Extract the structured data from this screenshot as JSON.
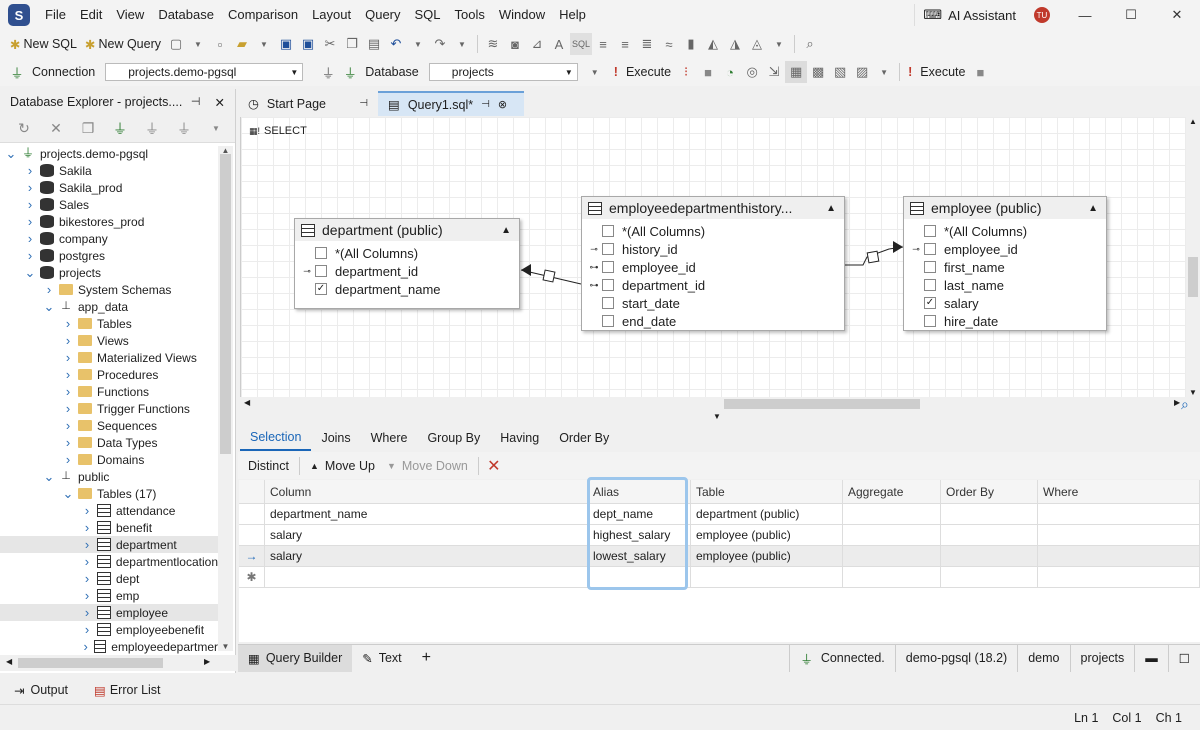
{
  "menu": [
    "File",
    "Edit",
    "View",
    "Database",
    "Comparison",
    "Layout",
    "Query",
    "SQL",
    "Tools",
    "Window",
    "Help"
  ],
  "ai_assistant": "AI Assistant",
  "user_initials": "TU",
  "toolbar1": {
    "new_sql": "New SQL",
    "new_query": "New Query"
  },
  "toolbar2": {
    "connection_label": "Connection",
    "connection_value": "projects.demo-pgsql",
    "database_label": "Database",
    "database_value": "projects",
    "execute": "Execute",
    "execute2": "Execute"
  },
  "explorer": {
    "title": "Database Explorer - projects....",
    "tree": [
      {
        "label": "projects.demo-pgsql",
        "depth": 0,
        "icon": "plug",
        "arrow": "open"
      },
      {
        "label": "Sakila",
        "depth": 1,
        "icon": "db",
        "arrow": "closed"
      },
      {
        "label": "Sakila_prod",
        "depth": 1,
        "icon": "db",
        "arrow": "closed"
      },
      {
        "label": "Sales",
        "depth": 1,
        "icon": "db",
        "arrow": "closed"
      },
      {
        "label": "bikestores_prod",
        "depth": 1,
        "icon": "db",
        "arrow": "closed"
      },
      {
        "label": "company",
        "depth": 1,
        "icon": "db",
        "arrow": "closed"
      },
      {
        "label": "postgres",
        "depth": 1,
        "icon": "db",
        "arrow": "closed"
      },
      {
        "label": "projects",
        "depth": 1,
        "icon": "db",
        "arrow": "open"
      },
      {
        "label": "System Schemas",
        "depth": 2,
        "icon": "folder",
        "arrow": "closed"
      },
      {
        "label": "app_data",
        "depth": 2,
        "icon": "schema",
        "arrow": "open"
      },
      {
        "label": "Tables",
        "depth": 3,
        "icon": "folder",
        "arrow": "closed"
      },
      {
        "label": "Views",
        "depth": 3,
        "icon": "folder",
        "arrow": "closed"
      },
      {
        "label": "Materialized Views",
        "depth": 3,
        "icon": "folder",
        "arrow": "closed"
      },
      {
        "label": "Procedures",
        "depth": 3,
        "icon": "folder",
        "arrow": "closed"
      },
      {
        "label": "Functions",
        "depth": 3,
        "icon": "folder",
        "arrow": "closed"
      },
      {
        "label": "Trigger Functions",
        "depth": 3,
        "icon": "folder",
        "arrow": "closed"
      },
      {
        "label": "Sequences",
        "depth": 3,
        "icon": "folder",
        "arrow": "closed"
      },
      {
        "label": "Data Types",
        "depth": 3,
        "icon": "folder",
        "arrow": "closed"
      },
      {
        "label": "Domains",
        "depth": 3,
        "icon": "folder",
        "arrow": "closed"
      },
      {
        "label": "public",
        "depth": 2,
        "icon": "schema",
        "arrow": "open"
      },
      {
        "label": "Tables (17)",
        "depth": 3,
        "icon": "folder",
        "arrow": "open"
      },
      {
        "label": "attendance",
        "depth": 4,
        "icon": "table",
        "arrow": "closed"
      },
      {
        "label": "benefit",
        "depth": 4,
        "icon": "table",
        "arrow": "closed"
      },
      {
        "label": "department",
        "depth": 4,
        "icon": "table",
        "arrow": "closed",
        "selected": true
      },
      {
        "label": "departmentlocation",
        "depth": 4,
        "icon": "table",
        "arrow": "closed"
      },
      {
        "label": "dept",
        "depth": 4,
        "icon": "table",
        "arrow": "closed"
      },
      {
        "label": "emp",
        "depth": 4,
        "icon": "table",
        "arrow": "closed"
      },
      {
        "label": "employee",
        "depth": 4,
        "icon": "table",
        "arrow": "closed",
        "selected": true
      },
      {
        "label": "employeebenefit",
        "depth": 4,
        "icon": "table",
        "arrow": "closed"
      },
      {
        "label": "employeedepartmer",
        "depth": 4,
        "icon": "table",
        "arrow": "closed"
      }
    ]
  },
  "tabs": {
    "start_page": "Start Page",
    "query1": "Query1.sql*"
  },
  "diagram": {
    "select_label": "SELECT",
    "entities": [
      {
        "title": "department (public)",
        "rows": [
          {
            "label": "*(All Columns)",
            "checked": false,
            "key": ""
          },
          {
            "label": "department_id",
            "checked": false,
            "key": "pk"
          },
          {
            "label": "department_name",
            "checked": true,
            "key": ""
          }
        ]
      },
      {
        "title": "employeedepartmenthistory...",
        "rows": [
          {
            "label": "*(All Columns)",
            "checked": false,
            "key": ""
          },
          {
            "label": "history_id",
            "checked": false,
            "key": "pk"
          },
          {
            "label": "employee_id",
            "checked": false,
            "key": "fk"
          },
          {
            "label": "department_id",
            "checked": false,
            "key": "fk"
          },
          {
            "label": "start_date",
            "checked": false,
            "key": ""
          },
          {
            "label": "end_date",
            "checked": false,
            "key": ""
          }
        ]
      },
      {
        "title": "employee (public)",
        "rows": [
          {
            "label": "*(All Columns)",
            "checked": false,
            "key": ""
          },
          {
            "label": "employee_id",
            "checked": false,
            "key": "pk"
          },
          {
            "label": "first_name",
            "checked": false,
            "key": ""
          },
          {
            "label": "last_name",
            "checked": false,
            "key": ""
          },
          {
            "label": "salary",
            "checked": true,
            "key": ""
          },
          {
            "label": "hire_date",
            "checked": false,
            "key": ""
          }
        ]
      }
    ]
  },
  "query_tabs": [
    "Selection",
    "Joins",
    "Where",
    "Group By",
    "Having",
    "Order By"
  ],
  "query_tools": {
    "distinct": "Distinct",
    "move_up": "Move Up",
    "move_down": "Move Down"
  },
  "grid": {
    "headers": [
      "Column",
      "Alias",
      "Table",
      "Aggregate",
      "Order By",
      "Where"
    ],
    "rows": [
      [
        "department_name",
        "dept_name",
        "department (public)",
        "",
        "",
        ""
      ],
      [
        "salary",
        "highest_salary",
        "employee (public)",
        "",
        "",
        ""
      ],
      [
        "salary",
        "lowest_salary",
        "employee (public)",
        "",
        "",
        ""
      ],
      [
        "",
        "",
        "",
        "",
        "",
        ""
      ]
    ]
  },
  "bottom": {
    "query_builder": "Query Builder",
    "text": "Text",
    "connected": "Connected.",
    "server": "demo-pgsql (18.2)",
    "user": "demo",
    "database": "projects"
  },
  "output": {
    "output": "Output",
    "error_list": "Error List"
  },
  "status": {
    "ln": "Ln 1",
    "col": "Col 1",
    "ch": "Ch 1"
  }
}
